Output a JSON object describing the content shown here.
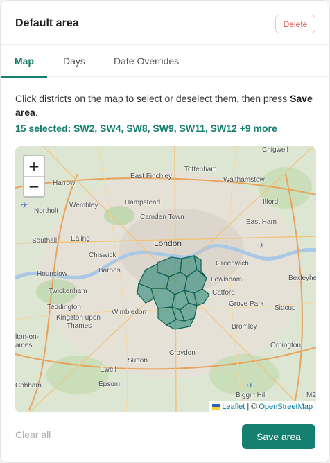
{
  "header": {
    "title": "Default area",
    "delete_label": "Delete"
  },
  "tabs": [
    {
      "label": "Map",
      "active": true
    },
    {
      "label": "Days",
      "active": false
    },
    {
      "label": "Date Overrides",
      "active": false
    }
  ],
  "instructions": {
    "text_before": "Click districts on the map to select or deselect them, then press ",
    "emphasis": "Save area",
    "text_after": "."
  },
  "selection": {
    "summary": "15 selected: SW2, SW4, SW8, SW9, SW11, SW12 +9 more"
  },
  "map": {
    "zoom_in": "+",
    "zoom_out": "−",
    "places": [
      "Chigwell",
      "Tottenham",
      "Walthamstow",
      "East Finchley",
      "Harrow",
      "Wembley",
      "Hampstead",
      "Northolt",
      "Camden Town",
      "Ilford",
      "East Ham",
      "Southall",
      "Ealing",
      "London",
      "Chiswick",
      "Greenwich",
      "Barnes",
      "Hounslow",
      "Lewisham",
      "Bexleyhe",
      "Twickenham",
      "Catford",
      "Grove Park",
      "Teddington",
      "Sidcup",
      "Wimbledon",
      "Kingston upon",
      "Thames",
      "Bromley",
      "lton-on-",
      "ames",
      "Croydon",
      "Sutton",
      "Orpington",
      "Ewell",
      "Epsom",
      "Cobham",
      "Biggin Hill",
      "M2"
    ],
    "attribution": {
      "leaflet": "Leaflet",
      "separator": "| ©",
      "osm": "OpenStreetMap"
    },
    "accent_color": "#15806f"
  },
  "footer": {
    "clear_label": "Clear all",
    "save_label": "Save area"
  }
}
